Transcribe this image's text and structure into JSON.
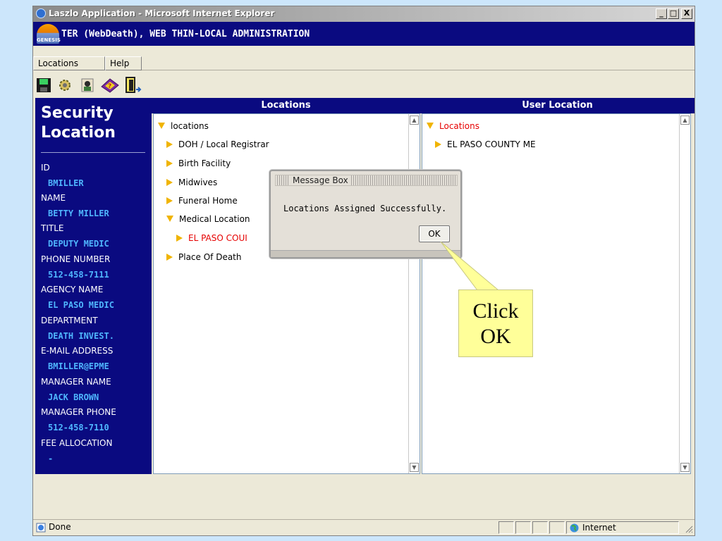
{
  "window": {
    "title": "Laszlo Application - Microsoft Internet Explorer",
    "minimize": "_",
    "maximize": "□",
    "close": "X"
  },
  "header": {
    "logo_text": "GENESIS",
    "title": "TER (WebDeath), WEB THIN-LOCAL ADMINISTRATION"
  },
  "menu": {
    "items": [
      "Locations",
      "Help"
    ]
  },
  "toolbar": {
    "icons": [
      "save-icon",
      "settings-gear-icon",
      "user-icon",
      "help-book-icon",
      "exit-door-icon"
    ]
  },
  "sidebar": {
    "heading_line1": "Security",
    "heading_line2": "Location",
    "fields": [
      {
        "label": "ID",
        "value": "BMILLER"
      },
      {
        "label": "NAME",
        "value": "BETTY MILLER"
      },
      {
        "label": "TITLE",
        "value": "DEPUTY MEDIC"
      },
      {
        "label": "PHONE NUMBER",
        "value": "512-458-7111"
      },
      {
        "label": "AGENCY NAME",
        "value": "EL PASO MEDIC"
      },
      {
        "label": "DEPARTMENT",
        "value": "DEATH INVEST."
      },
      {
        "label": "E-MAIL ADDRESS",
        "value": "BMILLER@EPME"
      },
      {
        "label": "MANAGER NAME",
        "value": "JACK BROWN"
      },
      {
        "label": "MANAGER PHONE",
        "value": "512-458-7110"
      },
      {
        "label": "FEE ALLOCATION",
        "value": "-"
      }
    ]
  },
  "locations_panel": {
    "header": "Locations",
    "tree": [
      {
        "label": "locations",
        "expanded": true
      },
      {
        "label": "DOH / Local Registrar",
        "expanded": false
      },
      {
        "label": "Birth Facility",
        "expanded": false
      },
      {
        "label": "Midwives",
        "expanded": false
      },
      {
        "label": "Funeral Home",
        "expanded": false
      },
      {
        "label": "Medical Location",
        "expanded": true
      },
      {
        "label": "EL PASO COUI",
        "expanded": false,
        "highlight": true
      },
      {
        "label": "Place Of Death",
        "expanded": false
      }
    ]
  },
  "user_location_panel": {
    "header": "User Location",
    "tree": [
      {
        "label": "Locations",
        "expanded": true,
        "highlight": true
      },
      {
        "label": "EL PASO COUNTY ME",
        "expanded": false
      }
    ]
  },
  "message_box": {
    "title": "Message Box",
    "message": "Locations Assigned Successfully.",
    "ok_label": "OK"
  },
  "callout": {
    "line1": "Click",
    "line2": "OK"
  },
  "statusbar": {
    "status": "Done",
    "zone": "Internet"
  },
  "colors": {
    "header_bg": "#0a0a80",
    "field_value": "#4fb6ff",
    "highlight_text": "#e60000",
    "callout_bg": "#ffff99",
    "tree_arrow": "#f0b400"
  }
}
